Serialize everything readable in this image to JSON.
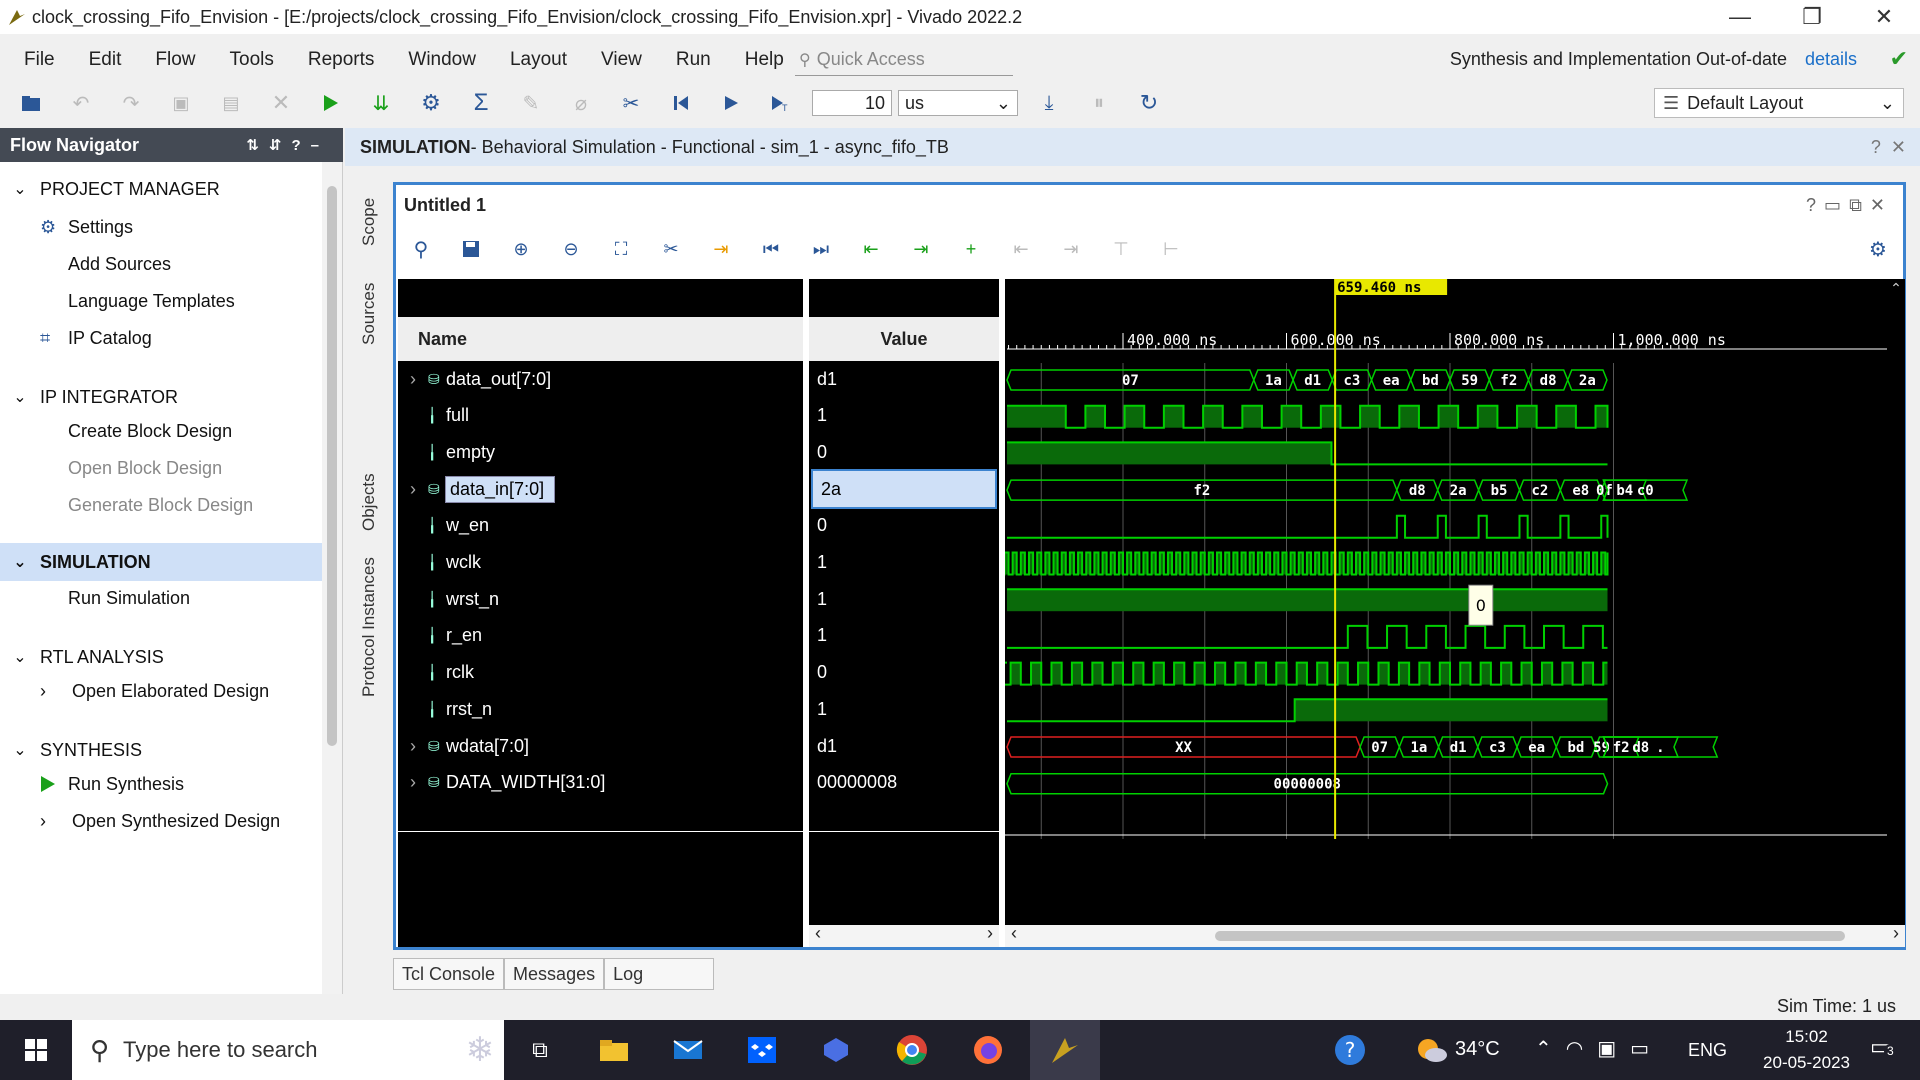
{
  "window": {
    "title": "clock_crossing_Fifo_Envision - [E:/projects/clock_crossing_Fifo_Envision/clock_crossing_Fifo_Envision.xpr] - Vivado 2022.2"
  },
  "menu": [
    "File",
    "Edit",
    "Flow",
    "Tools",
    "Reports",
    "Window",
    "Layout",
    "View",
    "Run",
    "Help"
  ],
  "quick_access": "Quick Access",
  "status": {
    "message": "Synthesis and Implementation Out-of-date",
    "link": "details"
  },
  "toolbar": {
    "time_value": "10",
    "time_unit": "us",
    "layout": "Default Layout"
  },
  "flow_navigator": {
    "title": "Flow Navigator",
    "sections": [
      {
        "label": "PROJECT MANAGER",
        "items": [
          {
            "label": "Settings"
          },
          {
            "label": "Add Sources"
          },
          {
            "label": "Language Templates"
          },
          {
            "label": "IP Catalog"
          }
        ]
      },
      {
        "label": "IP INTEGRATOR",
        "items": [
          {
            "label": "Create Block Design"
          },
          {
            "label": "Open Block Design"
          },
          {
            "label": "Generate Block Design"
          }
        ]
      },
      {
        "label": "SIMULATION",
        "items": [
          {
            "label": "Run Simulation"
          }
        ]
      },
      {
        "label": "RTL ANALYSIS",
        "items": [
          {
            "label": "Open Elaborated Design"
          }
        ]
      },
      {
        "label": "SYNTHESIS",
        "items": [
          {
            "label": "Run Synthesis"
          },
          {
            "label": "Open Synthesized Design"
          }
        ]
      }
    ]
  },
  "sim_header": {
    "bold": "SIMULATION",
    "rest": " - Behavioral Simulation - Functional - sim_1 - async_fifo_TB"
  },
  "side_tabs": [
    "Scope",
    "Sources",
    "Objects",
    "Protocol Instances"
  ],
  "wave_window": {
    "title": "Untitled 1",
    "cursor_label": "659.460 ns",
    "time_labels": [
      "400.000 ns",
      "600.000 ns",
      "800.000 ns",
      "1,000.000 ns"
    ],
    "name_header": "Name",
    "value_header": "Value",
    "tooltip": "0",
    "signals": [
      {
        "name": "data_out[7:0]",
        "value": "d1",
        "bus": true,
        "first": "07",
        "values": [
          "1a",
          "d1",
          "c3",
          "ea",
          "bd",
          "59",
          "f2",
          "d8",
          "2a"
        ]
      },
      {
        "name": "full",
        "value": "1"
      },
      {
        "name": "empty",
        "value": "0"
      },
      {
        "name": "data_in[7:0]",
        "value": "2a",
        "bus": true,
        "first": "f2",
        "values": [
          "d8",
          "2a",
          "b5",
          "c2",
          "e8",
          "0f",
          "b4",
          "c0"
        ]
      },
      {
        "name": "w_en",
        "value": "0"
      },
      {
        "name": "wclk",
        "value": "1"
      },
      {
        "name": "wrst_n",
        "value": "1"
      },
      {
        "name": "r_en",
        "value": "1"
      },
      {
        "name": "rclk",
        "value": "0"
      },
      {
        "name": "rrst_n",
        "value": "1"
      },
      {
        "name": "wdata[7:0]",
        "value": "d1",
        "bus": true,
        "first": "XX",
        "values": [
          "07",
          "1a",
          "d1",
          "c3",
          "ea",
          "bd",
          "59",
          "f2",
          "d8",
          "."
        ]
      },
      {
        "name": "DATA_WIDTH[31:0]",
        "value": "00000008",
        "bus": true,
        "first": "00000008",
        "values": []
      }
    ]
  },
  "bottom_tabs": [
    "Tcl Console",
    "Messages",
    "Log"
  ],
  "sim_time": "Sim Time: 1 us",
  "taskbar": {
    "search": "Type here to search",
    "temp": "34°C",
    "lang": "ENG",
    "time": "15:02",
    "date": "20-05-2023",
    "notifications": "3"
  },
  "colors": {
    "wave_green": "#00d000",
    "bus_text": "#ffffff",
    "cursor": "#e8e800",
    "accent": "#3c83cf",
    "nav_head": "#444a54",
    "selected": "#cfe0f7"
  }
}
